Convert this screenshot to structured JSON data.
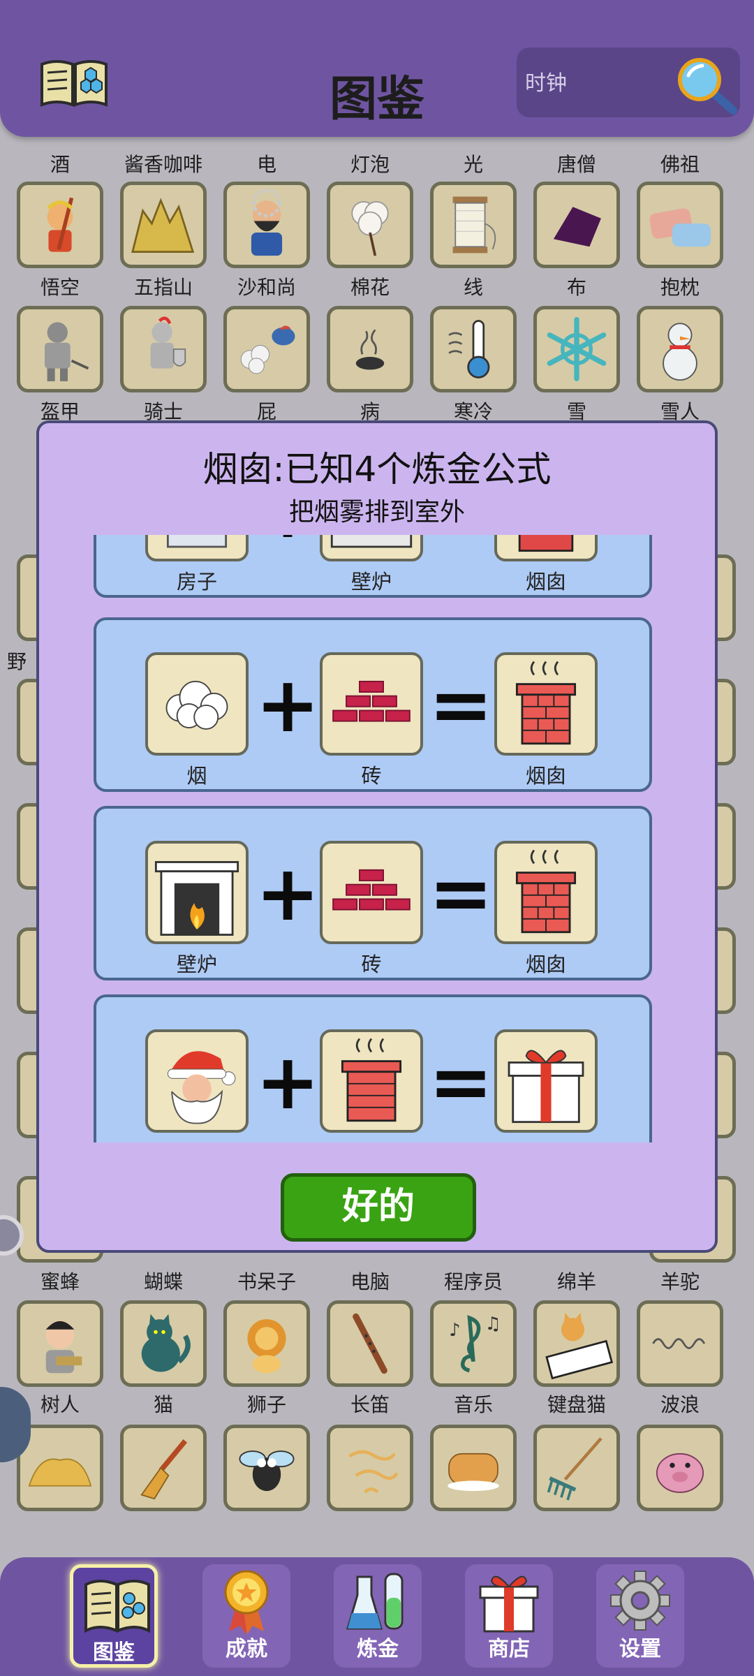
{
  "header": {
    "title": "图鉴",
    "search_placeholder": "时钟"
  },
  "grid": {
    "row0_labels": [
      "酒",
      "酱香咖啡",
      "电",
      "灯泡",
      "光",
      "唐僧",
      "佛祖"
    ],
    "row1_labels": [
      "悟空",
      "五指山",
      "沙和尚",
      "棉花",
      "线",
      "布",
      "抱枕"
    ],
    "row2_labels": [
      "盔甲",
      "骑士",
      "屁",
      "病",
      "寒冷",
      "雪",
      "雪人"
    ],
    "row8_labels": [
      "蜜蜂",
      "蝴蝶",
      "书呆子",
      "电脑",
      "程序员",
      "绵羊",
      "羊驼"
    ],
    "row9_labels": [
      "树人",
      "猫",
      "狮子",
      "长笛",
      "音乐",
      "键盘猫",
      "波浪"
    ],
    "row10_icons": [
      "hay-icon",
      "broom-icon",
      "fly-icon",
      "smoke-icon",
      "sponge-icon",
      "rake-icon",
      "pig-icon"
    ],
    "left_partial_labels": [
      "野"
    ]
  },
  "modal": {
    "title": "烟囱:已知4个炼金公式",
    "subtitle": "把烟雾排到室外",
    "ok_label": "好的",
    "recipes": [
      {
        "a": "房子",
        "b": "壁炉",
        "result": "烟囱"
      },
      {
        "a": "烟",
        "b": "砖",
        "result": "烟囱"
      },
      {
        "a": "壁炉",
        "b": "砖",
        "result": "烟囱"
      },
      {
        "a": "圣诞老人",
        "b": "烟囱",
        "result": "礼物"
      }
    ],
    "plus": "+",
    "equals": "="
  },
  "nav": {
    "items": [
      {
        "label": "图鉴",
        "icon": "book-icon",
        "active": true
      },
      {
        "label": "成就",
        "icon": "medal-icon"
      },
      {
        "label": "炼金",
        "icon": "flask-icon"
      },
      {
        "label": "商店",
        "icon": "gift-icon"
      },
      {
        "label": "设置",
        "icon": "gear-icon"
      }
    ]
  },
  "colors": {
    "header": "#6f55a1",
    "modal": "#ccb5ef",
    "recipe_card": "#aecbf5",
    "ok_button": "#3aa313",
    "cell": "#d6cba6"
  }
}
